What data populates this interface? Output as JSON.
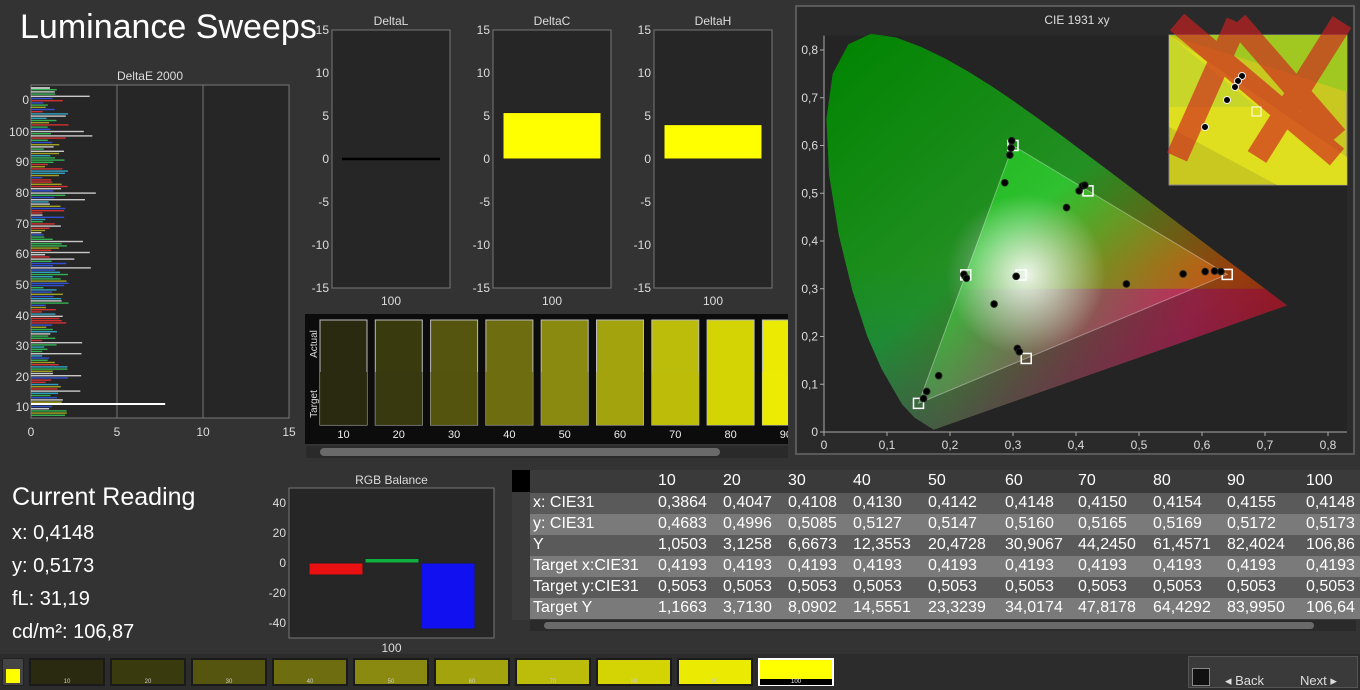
{
  "page_title": "Luminance Sweeps",
  "colors": {
    "yellow": "#ffff00",
    "bg": "#333333",
    "panel": "#262626"
  },
  "chart_data": [
    {
      "type": "bar",
      "title": "DeltaE 2000",
      "orientation": "horizontal",
      "xlim": [
        0,
        15
      ],
      "xticks": [
        "0",
        "5",
        "10",
        "15"
      ],
      "yticks": [
        "0",
        "100",
        "90",
        "80",
        "70",
        "60",
        "50",
        "40",
        "30",
        "20",
        "10"
      ],
      "grid": true
    },
    {
      "type": "bar",
      "title": "DeltaL",
      "categories": [
        "100"
      ],
      "values": [
        0
      ],
      "ylim": [
        -15,
        15
      ],
      "yticks": [
        "15",
        "10",
        "5",
        "0",
        "-5",
        "-10",
        "-15"
      ]
    },
    {
      "type": "bar",
      "title": "DeltaC",
      "categories": [
        "100"
      ],
      "values": [
        5.4
      ],
      "ylim": [
        -15,
        15
      ],
      "yticks": [
        "15",
        "10",
        "5",
        "0",
        "-5",
        "-10",
        "-15"
      ]
    },
    {
      "type": "bar",
      "title": "DeltaH",
      "categories": [
        "100"
      ],
      "values": [
        4.0
      ],
      "ylim": [
        -15,
        15
      ],
      "yticks": [
        "15",
        "10",
        "5",
        "0",
        "-5",
        "-10",
        "-15"
      ]
    },
    {
      "type": "bar",
      "title": "RGB Balance",
      "categories": [
        "100"
      ],
      "series": [
        {
          "color": "#e81010",
          "values": [
            -8
          ]
        },
        {
          "color": "#10b040",
          "values": [
            3
          ]
        },
        {
          "color": "#1010f0",
          "values": [
            -44
          ]
        }
      ],
      "ylim": [
        -50,
        50
      ],
      "yticks": [
        "40",
        "20",
        "0",
        "-20",
        "-40"
      ]
    },
    {
      "type": "scatter",
      "title": "CIE 1931 xy",
      "xlim": [
        0,
        0.85
      ],
      "ylim": [
        0,
        0.85
      ],
      "xticks": [
        "0",
        "0,1",
        "0,2",
        "0,3",
        "0,4",
        "0,5",
        "0,6",
        "0,7",
        "0,8"
      ],
      "yticks": [
        "0",
        "0,1",
        "0,2",
        "0,3",
        "0,4",
        "0,5",
        "0,6",
        "0,7",
        "0,8"
      ],
      "targets": [
        {
          "x": 0.64,
          "y": 0.33
        },
        {
          "x": 0.3,
          "y": 0.6
        },
        {
          "x": 0.15,
          "y": 0.06
        },
        {
          "x": 0.225,
          "y": 0.329
        },
        {
          "x": 0.321,
          "y": 0.154
        },
        {
          "x": 0.419,
          "y": 0.505
        },
        {
          "x": 0.3127,
          "y": 0.329
        }
      ],
      "measured": [
        {
          "x": 0.63,
          "y": 0.336
        },
        {
          "x": 0.62,
          "y": 0.337
        },
        {
          "x": 0.605,
          "y": 0.336
        },
        {
          "x": 0.57,
          "y": 0.331
        },
        {
          "x": 0.48,
          "y": 0.31
        },
        {
          "x": 0.298,
          "y": 0.61
        },
        {
          "x": 0.297,
          "y": 0.595
        },
        {
          "x": 0.295,
          "y": 0.58
        },
        {
          "x": 0.287,
          "y": 0.522
        },
        {
          "x": 0.385,
          "y": 0.47
        },
        {
          "x": 0.405,
          "y": 0.505
        },
        {
          "x": 0.41,
          "y": 0.515
        },
        {
          "x": 0.414,
          "y": 0.517
        },
        {
          "x": 0.222,
          "y": 0.33
        },
        {
          "x": 0.226,
          "y": 0.322
        },
        {
          "x": 0.305,
          "y": 0.326
        },
        {
          "x": 0.27,
          "y": 0.268
        },
        {
          "x": 0.307,
          "y": 0.175
        },
        {
          "x": 0.31,
          "y": 0.168
        },
        {
          "x": 0.182,
          "y": 0.118
        },
        {
          "x": 0.163,
          "y": 0.085
        },
        {
          "x": 0.158,
          "y": 0.07
        }
      ]
    }
  ],
  "swatches": {
    "row_labels": [
      "Actual",
      "Target"
    ],
    "labels": [
      "10",
      "20",
      "30",
      "40",
      "50",
      "60",
      "70",
      "80",
      "90"
    ],
    "colors": [
      "#2a2a10",
      "#3a3a0f",
      "#55550f",
      "#6e6e10",
      "#8a8a10",
      "#a3a30e",
      "#bcbc0a",
      "#d4d405",
      "#eaea03"
    ]
  },
  "current_reading": {
    "title": "Current Reading",
    "x": "x: 0,4148",
    "y": "y: 0,5173",
    "fl": "fL: 31,19",
    "cd": "cd/m²: 106,87"
  },
  "table": {
    "columns": [
      "10",
      "20",
      "30",
      "40",
      "50",
      "60",
      "70",
      "80",
      "90",
      "100"
    ],
    "rows": [
      {
        "label": "x: CIE31",
        "values": [
          "0,3864",
          "0,4047",
          "0,4108",
          "0,4130",
          "0,4142",
          "0,4148",
          "0,4150",
          "0,4154",
          "0,4155",
          "0,4148"
        ]
      },
      {
        "label": "y: CIE31",
        "values": [
          "0,4683",
          "0,4996",
          "0,5085",
          "0,5127",
          "0,5147",
          "0,5160",
          "0,5165",
          "0,5169",
          "0,5172",
          "0,5173"
        ]
      },
      {
        "label": "Y",
        "values": [
          "1,0503",
          "3,1258",
          "6,6673",
          "12,3553",
          "20,4728",
          "30,9067",
          "44,2450",
          "61,4571",
          "82,4024",
          "106,86"
        ]
      },
      {
        "label": "Target x:CIE31",
        "values": [
          "0,4193",
          "0,4193",
          "0,4193",
          "0,4193",
          "0,4193",
          "0,4193",
          "0,4193",
          "0,4193",
          "0,4193",
          "0,4193"
        ]
      },
      {
        "label": "Target y:CIE31",
        "values": [
          "0,5053",
          "0,5053",
          "0,5053",
          "0,5053",
          "0,5053",
          "0,5053",
          "0,5053",
          "0,5053",
          "0,5053",
          "0,5053"
        ]
      },
      {
        "label": "Target Y",
        "values": [
          "1,1663",
          "3,7130",
          "8,0902",
          "14,5551",
          "23,3239",
          "34,0174",
          "47,8178",
          "64,4292",
          "83,9950",
          "106,64"
        ]
      }
    ]
  },
  "bottom_bar": {
    "labels": [
      "10",
      "20",
      "30",
      "40",
      "50",
      "60",
      "70",
      "80",
      "90",
      "100"
    ],
    "colors": [
      "#2a2a10",
      "#3a3a0f",
      "#55550f",
      "#6e6e10",
      "#8a8a10",
      "#a3a30e",
      "#bcbc0a",
      "#d4d405",
      "#eaea03",
      "#ffff00"
    ],
    "back_label": "Back",
    "next_label": "Next"
  }
}
